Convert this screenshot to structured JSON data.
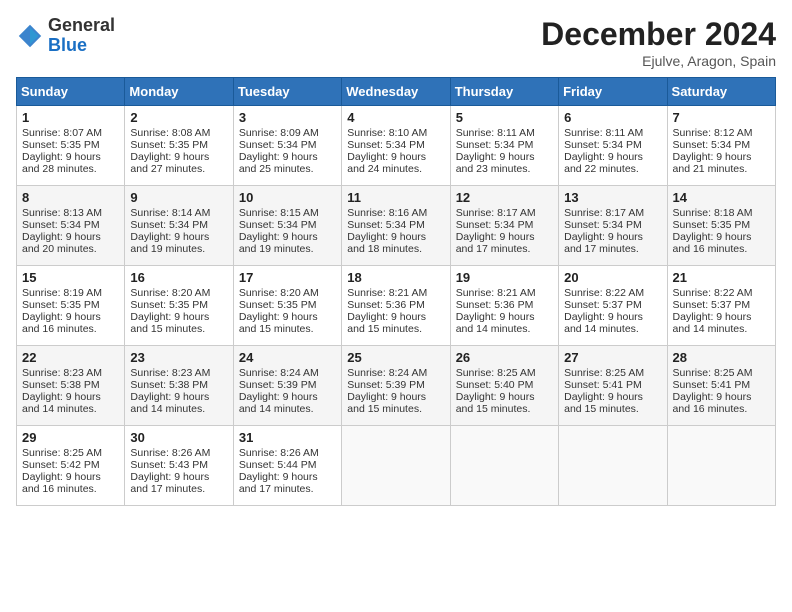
{
  "header": {
    "logo_general": "General",
    "logo_blue": "Blue",
    "month_title": "December 2024",
    "location": "Ejulve, Aragon, Spain"
  },
  "days_of_week": [
    "Sunday",
    "Monday",
    "Tuesday",
    "Wednesday",
    "Thursday",
    "Friday",
    "Saturday"
  ],
  "weeks": [
    [
      {
        "day": "1",
        "info": "Sunrise: 8:07 AM\nSunset: 5:35 PM\nDaylight: 9 hours and 28 minutes."
      },
      {
        "day": "2",
        "info": "Sunrise: 8:08 AM\nSunset: 5:35 PM\nDaylight: 9 hours and 27 minutes."
      },
      {
        "day": "3",
        "info": "Sunrise: 8:09 AM\nSunset: 5:34 PM\nDaylight: 9 hours and 25 minutes."
      },
      {
        "day": "4",
        "info": "Sunrise: 8:10 AM\nSunset: 5:34 PM\nDaylight: 9 hours and 24 minutes."
      },
      {
        "day": "5",
        "info": "Sunrise: 8:11 AM\nSunset: 5:34 PM\nDaylight: 9 hours and 23 minutes."
      },
      {
        "day": "6",
        "info": "Sunrise: 8:11 AM\nSunset: 5:34 PM\nDaylight: 9 hours and 22 minutes."
      },
      {
        "day": "7",
        "info": "Sunrise: 8:12 AM\nSunset: 5:34 PM\nDaylight: 9 hours and 21 minutes."
      }
    ],
    [
      {
        "day": "8",
        "info": "Sunrise: 8:13 AM\nSunset: 5:34 PM\nDaylight: 9 hours and 20 minutes."
      },
      {
        "day": "9",
        "info": "Sunrise: 8:14 AM\nSunset: 5:34 PM\nDaylight: 9 hours and 19 minutes."
      },
      {
        "day": "10",
        "info": "Sunrise: 8:15 AM\nSunset: 5:34 PM\nDaylight: 9 hours and 19 minutes."
      },
      {
        "day": "11",
        "info": "Sunrise: 8:16 AM\nSunset: 5:34 PM\nDaylight: 9 hours and 18 minutes."
      },
      {
        "day": "12",
        "info": "Sunrise: 8:17 AM\nSunset: 5:34 PM\nDaylight: 9 hours and 17 minutes."
      },
      {
        "day": "13",
        "info": "Sunrise: 8:17 AM\nSunset: 5:34 PM\nDaylight: 9 hours and 17 minutes."
      },
      {
        "day": "14",
        "info": "Sunrise: 8:18 AM\nSunset: 5:35 PM\nDaylight: 9 hours and 16 minutes."
      }
    ],
    [
      {
        "day": "15",
        "info": "Sunrise: 8:19 AM\nSunset: 5:35 PM\nDaylight: 9 hours and 16 minutes."
      },
      {
        "day": "16",
        "info": "Sunrise: 8:20 AM\nSunset: 5:35 PM\nDaylight: 9 hours and 15 minutes."
      },
      {
        "day": "17",
        "info": "Sunrise: 8:20 AM\nSunset: 5:35 PM\nDaylight: 9 hours and 15 minutes."
      },
      {
        "day": "18",
        "info": "Sunrise: 8:21 AM\nSunset: 5:36 PM\nDaylight: 9 hours and 15 minutes."
      },
      {
        "day": "19",
        "info": "Sunrise: 8:21 AM\nSunset: 5:36 PM\nDaylight: 9 hours and 14 minutes."
      },
      {
        "day": "20",
        "info": "Sunrise: 8:22 AM\nSunset: 5:37 PM\nDaylight: 9 hours and 14 minutes."
      },
      {
        "day": "21",
        "info": "Sunrise: 8:22 AM\nSunset: 5:37 PM\nDaylight: 9 hours and 14 minutes."
      }
    ],
    [
      {
        "day": "22",
        "info": "Sunrise: 8:23 AM\nSunset: 5:38 PM\nDaylight: 9 hours and 14 minutes."
      },
      {
        "day": "23",
        "info": "Sunrise: 8:23 AM\nSunset: 5:38 PM\nDaylight: 9 hours and 14 minutes."
      },
      {
        "day": "24",
        "info": "Sunrise: 8:24 AM\nSunset: 5:39 PM\nDaylight: 9 hours and 14 minutes."
      },
      {
        "day": "25",
        "info": "Sunrise: 8:24 AM\nSunset: 5:39 PM\nDaylight: 9 hours and 15 minutes."
      },
      {
        "day": "26",
        "info": "Sunrise: 8:25 AM\nSunset: 5:40 PM\nDaylight: 9 hours and 15 minutes."
      },
      {
        "day": "27",
        "info": "Sunrise: 8:25 AM\nSunset: 5:41 PM\nDaylight: 9 hours and 15 minutes."
      },
      {
        "day": "28",
        "info": "Sunrise: 8:25 AM\nSunset: 5:41 PM\nDaylight: 9 hours and 16 minutes."
      }
    ],
    [
      {
        "day": "29",
        "info": "Sunrise: 8:25 AM\nSunset: 5:42 PM\nDaylight: 9 hours and 16 minutes."
      },
      {
        "day": "30",
        "info": "Sunrise: 8:26 AM\nSunset: 5:43 PM\nDaylight: 9 hours and 17 minutes."
      },
      {
        "day": "31",
        "info": "Sunrise: 8:26 AM\nSunset: 5:44 PM\nDaylight: 9 hours and 17 minutes."
      },
      {
        "day": "",
        "info": ""
      },
      {
        "day": "",
        "info": ""
      },
      {
        "day": "",
        "info": ""
      },
      {
        "day": "",
        "info": ""
      }
    ]
  ]
}
